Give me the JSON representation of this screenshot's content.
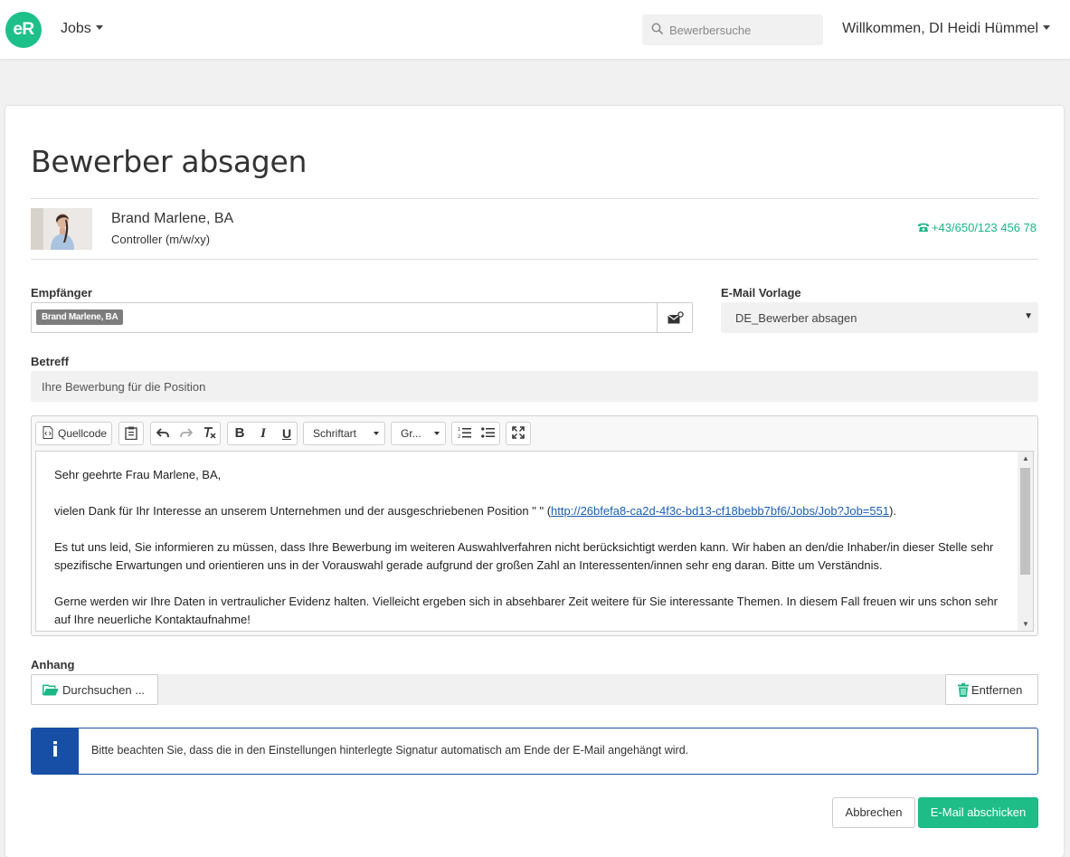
{
  "colors": {
    "brand": "#1ec08a",
    "info": "#174ea6",
    "link": "#1a5fb4"
  },
  "nav": {
    "logo": "eR",
    "jobs_label": "Jobs",
    "search_placeholder": "Bewerbersuche",
    "welcome": "Willkommen, DI Heidi Hümmel"
  },
  "page": {
    "title": "Bewerber absagen"
  },
  "candidate": {
    "name": "Brand Marlene, BA",
    "position": "Controller (m/w/xy)",
    "phone": "+43/650/123 456 78"
  },
  "form": {
    "recipient_label": "Empfänger",
    "recipient_tag": "Brand Marlene, BA",
    "template_label": "E-Mail Vorlage",
    "template_value": "DE_Bewerber absagen",
    "subject_label": "Betreff",
    "subject_value": "Ihre Bewerbung für die Position",
    "attachment_label": "Anhang",
    "browse_label": "Durchsuchen ...",
    "remove_label": "Entfernen"
  },
  "editor": {
    "toolbar": {
      "source_label": "Quellcode",
      "font_label": "Schriftart",
      "size_label": "Gr..."
    },
    "body": {
      "greeting": "Sehr geehrte Frau Marlene, BA,",
      "p1_text": "vielen Dank für Ihr Interesse an unserem Unternehmen und der ausgeschriebenen Position \" \" (",
      "p1_link": "http://26bfefa8-ca2d-4f3c-bd13-cf18bebb7bf6/Jobs/Job?Job=551",
      "p1_end": ").",
      "p2": "Es tut uns leid, Sie informieren zu müssen, dass Ihre Bewerbung im weiteren Auswahlverfahren nicht berücksichtigt werden kann. Wir haben an den/die Inhaber/in dieser Stelle sehr spezifische Erwartungen und orientieren uns in der Vorauswahl gerade aufgrund der großen Zahl an Interessenten/innen sehr eng daran. Bitte um Verständnis.",
      "p3": "Gerne werden wir Ihre Daten in vertraulicher Evidenz halten. Vielleicht ergeben sich in absehbarer Zeit weitere für Sie interessante Themen. In diesem Fall freuen wir uns schon sehr auf Ihre neuerliche Kontaktaufnahme!"
    }
  },
  "info": {
    "icon": "i",
    "text": "Bitte beachten Sie, dass die in den Einstellungen hinterlegte Signatur automatisch am Ende der E-Mail angehängt wird."
  },
  "actions": {
    "cancel": "Abbrechen",
    "send": "E-Mail abschicken"
  }
}
